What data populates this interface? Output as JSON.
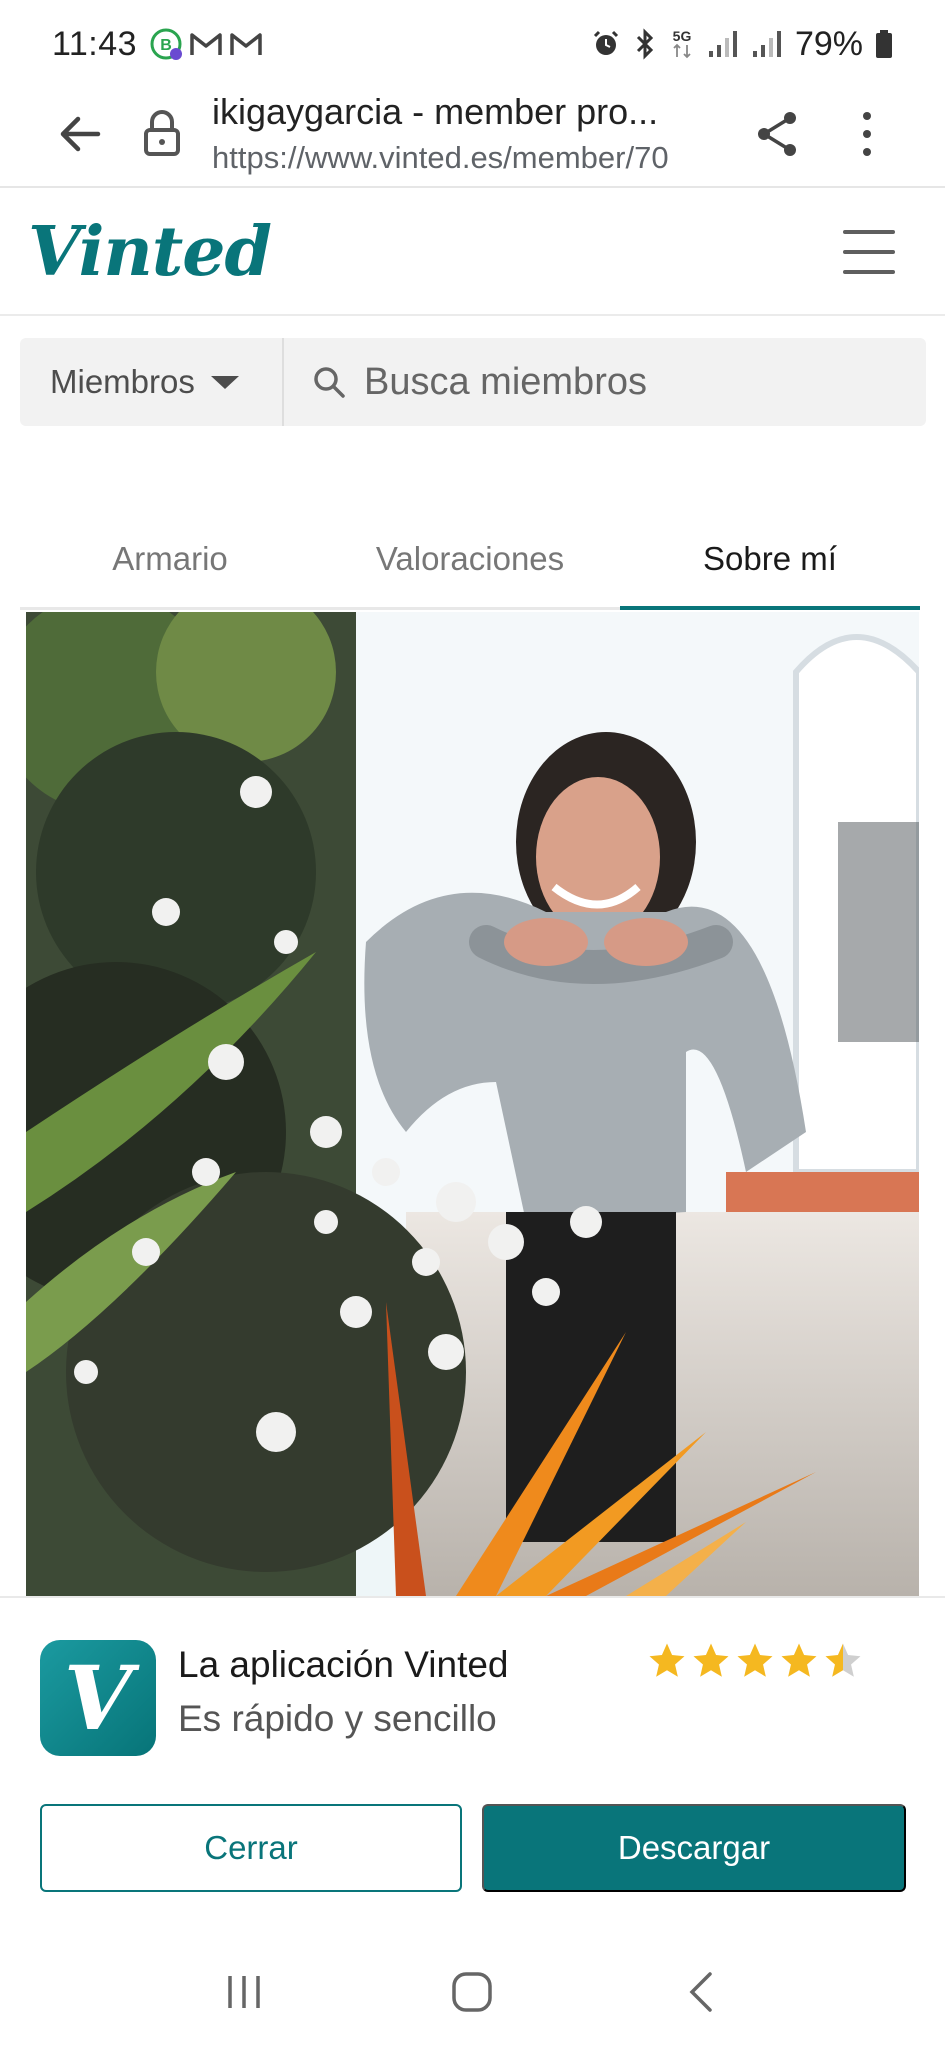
{
  "status_bar": {
    "time": "11:43",
    "battery": "79%",
    "network": "5G",
    "icons": [
      "whatsapp-business-icon",
      "gmail-icon",
      "gmail-icon",
      "alarm-icon",
      "bluetooth-icon",
      "signal-icon",
      "signal-icon",
      "battery-icon"
    ]
  },
  "browser": {
    "title": "ikigaygarcia - member pro...",
    "url": "https://www.vinted.es/member/70"
  },
  "header": {
    "logo": "Vinted"
  },
  "search": {
    "scope": "Miembros",
    "placeholder": "Busca miembros"
  },
  "tabs": [
    {
      "label": "Armario"
    },
    {
      "label": "Valoraciones"
    },
    {
      "label": "Sobre mí",
      "active": true
    }
  ],
  "app_banner": {
    "icon_letter": "V",
    "name": "La aplicación Vinted",
    "subtitle": "Es rápido y sencillo",
    "rating": 4.5,
    "close_label": "Cerrar",
    "download_label": "Descargar"
  },
  "colors": {
    "brand": "#09757a",
    "star": "#f5b820"
  }
}
